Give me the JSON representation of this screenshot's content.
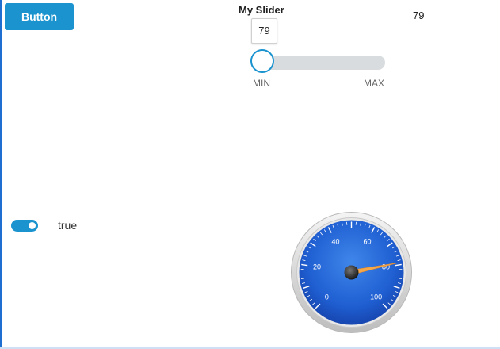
{
  "button": {
    "label": "Button"
  },
  "slider": {
    "title": "My Slider",
    "value": 79,
    "value_text": "79",
    "readout": "79",
    "min_label": "MIN",
    "max_label": "MAX",
    "fill_fraction": 0.0
  },
  "toggle": {
    "state": true,
    "label": "true"
  },
  "gauge": {
    "value": 79,
    "min": 0,
    "max": 100,
    "tick_labels": [
      "0",
      "20",
      "40",
      "60",
      "80",
      "100"
    ]
  },
  "colors": {
    "accent": "#1a93cf",
    "track": "#d8dcdf",
    "gauge_face": "#1f63d6",
    "gauge_needle": "#f5a84a"
  }
}
